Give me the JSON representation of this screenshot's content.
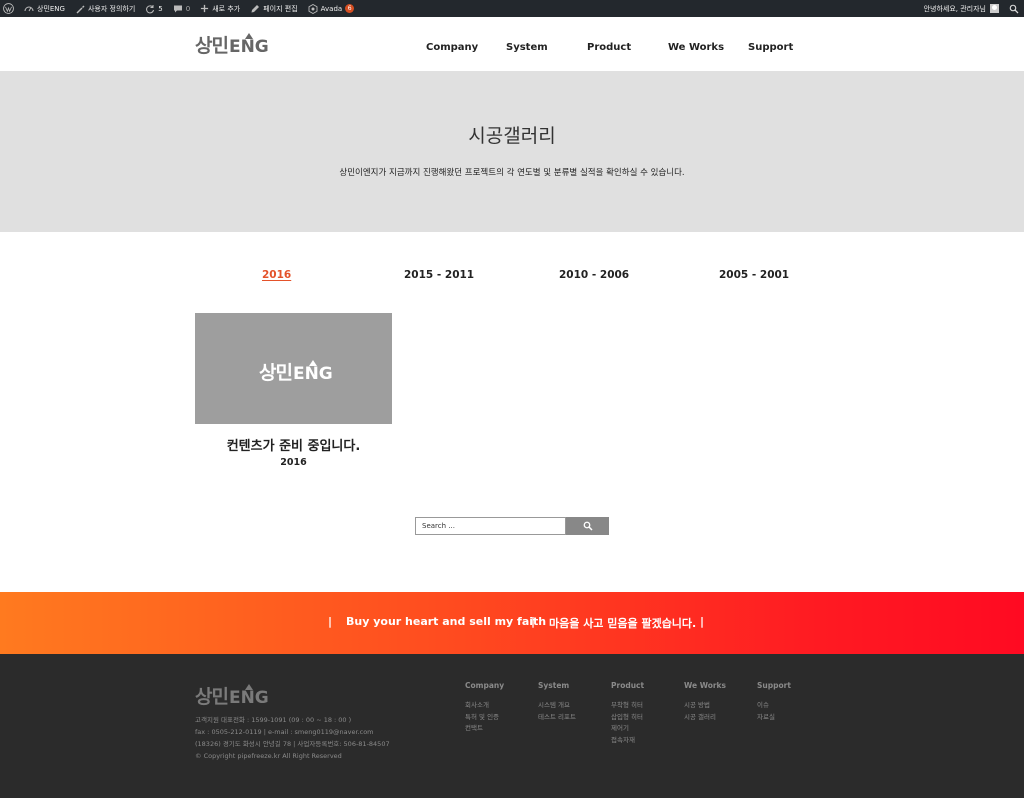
{
  "admin_bar": {
    "site_name": "상민ENG",
    "customize_label": "사용자 정의하기",
    "updates_count": "5",
    "comments_count": "0",
    "new_label": "새로 추가",
    "edit_page_label": "페이지 편집",
    "theme_label": "Avada",
    "theme_badge": "6",
    "greeting": "안녕하세요, 관리자님"
  },
  "header": {
    "logo_ko": "상민",
    "logo_en": "ENG",
    "nav": [
      "Company",
      "System",
      "Product",
      "We Works",
      "Support"
    ]
  },
  "hero": {
    "title": "시공갤러리",
    "subtitle": "상민이엔지가 지금까지 진행해왔던 프로젝트의 각 연도별 및 분류별 실적을 확인하실 수 있습니다."
  },
  "tabs": {
    "items": [
      "2016",
      "2015 - 2011",
      "2010 - 2006",
      "2005 - 2001"
    ],
    "active": "2016",
    "active_color": "#e4522a"
  },
  "gallery": {
    "items": [
      {
        "logo_ko": "상민",
        "logo_en": "ENG",
        "title": "컨텐츠가 준비 중입니다.",
        "year": "2016"
      }
    ]
  },
  "search": {
    "placeholder": "Search ..."
  },
  "banner": {
    "english": "Buy your heart and sell my faith",
    "korean": "마음을 사고 믿음을 팔겠습니다.",
    "gradient_start": "#ff7a1f",
    "gradient_end": "#ff0a22"
  },
  "footer": {
    "logo_ko": "상민",
    "logo_en": "ENG",
    "info": [
      "고객지원 대표전화 : 1599-1091 (09 : 00 ~ 18 : 00 )",
      "fax : 0505-212-0119 | e-mail : smeng0119@naver.com",
      "(18326) 경기도 화성시 안녕길 78 | 사업자등록번호: 506-81-84507",
      "© Copyright pipefreeze.kr All Right Reserved"
    ],
    "columns": [
      {
        "heading": "Company",
        "links": [
          "회사소개",
          "특허 및 인증",
          "컨택트"
        ]
      },
      {
        "heading": "System",
        "links": [
          "시스템 개요",
          "테스트 리포트"
        ]
      },
      {
        "heading": "Product",
        "links": [
          "부착형 히터",
          "삽입형 히터",
          "제어기",
          "접속자재"
        ]
      },
      {
        "heading": "We Works",
        "links": [
          "시공 방법",
          "시공 갤러리"
        ]
      },
      {
        "heading": "Support",
        "links": [
          "이슈",
          "자료실"
        ]
      }
    ]
  }
}
